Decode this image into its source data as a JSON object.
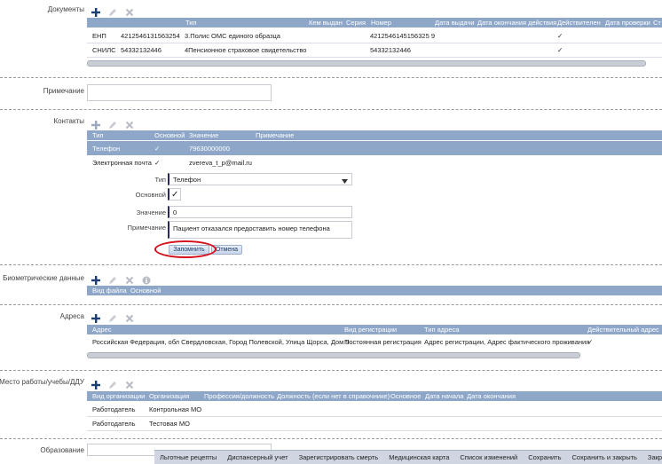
{
  "documents": {
    "label": "Документы",
    "headers": [
      "Тип",
      "Кем выдан",
      "Серия",
      "Номер",
      "Дата выдачи",
      "Дата окончания действия",
      "Действителен",
      "Дата проверки",
      "Ст"
    ],
    "rows": [
      {
        "short": "ЕНП",
        "code": "4212546131563254",
        "type": "3.Полис ОМС единого образца",
        "number": "4212546145156325 9",
        "check": "✓"
      },
      {
        "short": "СНИЛС",
        "code": "54332132446",
        "type": "4Пенсионное страховое свидетельство",
        "number": "54332132446",
        "check": "✓"
      }
    ]
  },
  "note": {
    "label": "Примечание",
    "value": ""
  },
  "contacts": {
    "label": "Контакты",
    "headers": [
      "Тип",
      "Основной",
      "Значение",
      "Примечание"
    ],
    "rows": [
      {
        "type": "Телефон",
        "main": "✓",
        "value": "79630000000",
        "note": ""
      },
      {
        "type": "Электронная почта",
        "main": "✓",
        "value": "zvereva_t_p@mail.ru",
        "note": ""
      }
    ],
    "form": {
      "type_label": "Тип",
      "type_value": "Телефон",
      "main_label": "Основной",
      "main_check": "✓",
      "value_label": "Значение",
      "value_value": "0",
      "note_label": "Примечание",
      "note_value": "Пациент отказался предоставить номер телефона",
      "save_label": "Запомнить",
      "cancel_label": "Отмена"
    }
  },
  "biometric": {
    "label": "Биометрические данные",
    "headers": [
      "Вид файла",
      "Основной"
    ]
  },
  "addresses": {
    "label": "Адреса",
    "headers": [
      "Адрес",
      "Вид регистрации",
      "Тип адреса",
      "Действительный адрес"
    ],
    "rows": [
      {
        "address": "Российская Федерация, обл Свердловская, Город Полевской, Улица Щорса, Дом 9",
        "reg": "Постоянная регистрация",
        "type": "Адрес регистрации, Адрес фактического проживания",
        "valid": "✓"
      }
    ]
  },
  "work": {
    "label": "Место работы/учебы/ДДУ",
    "headers": [
      "Вид организации",
      "Организация",
      "Профессия/должность",
      "Должность (если нет в справочнике)",
      "Основное",
      "Дата начала",
      "Дата окончания"
    ],
    "rows": [
      {
        "kind": "Работодатель",
        "org": "Контрольная МО"
      },
      {
        "kind": "Работодатель",
        "org": "Тестовая МО"
      }
    ]
  },
  "education": {
    "label": "Образование",
    "value": ""
  },
  "bottom_bar": [
    "Льготные рецепты",
    "Диспансерный учет",
    "Зарегистрировать смерть",
    "Медицинская карта",
    "Список изменений",
    "Сохранить",
    "Сохранить и закрыть",
    "Закрыть"
  ],
  "colors": {
    "header_blue": "#8ea7c9",
    "plus_blue": "#1e3f73",
    "annotation_red": "#d4111b"
  }
}
